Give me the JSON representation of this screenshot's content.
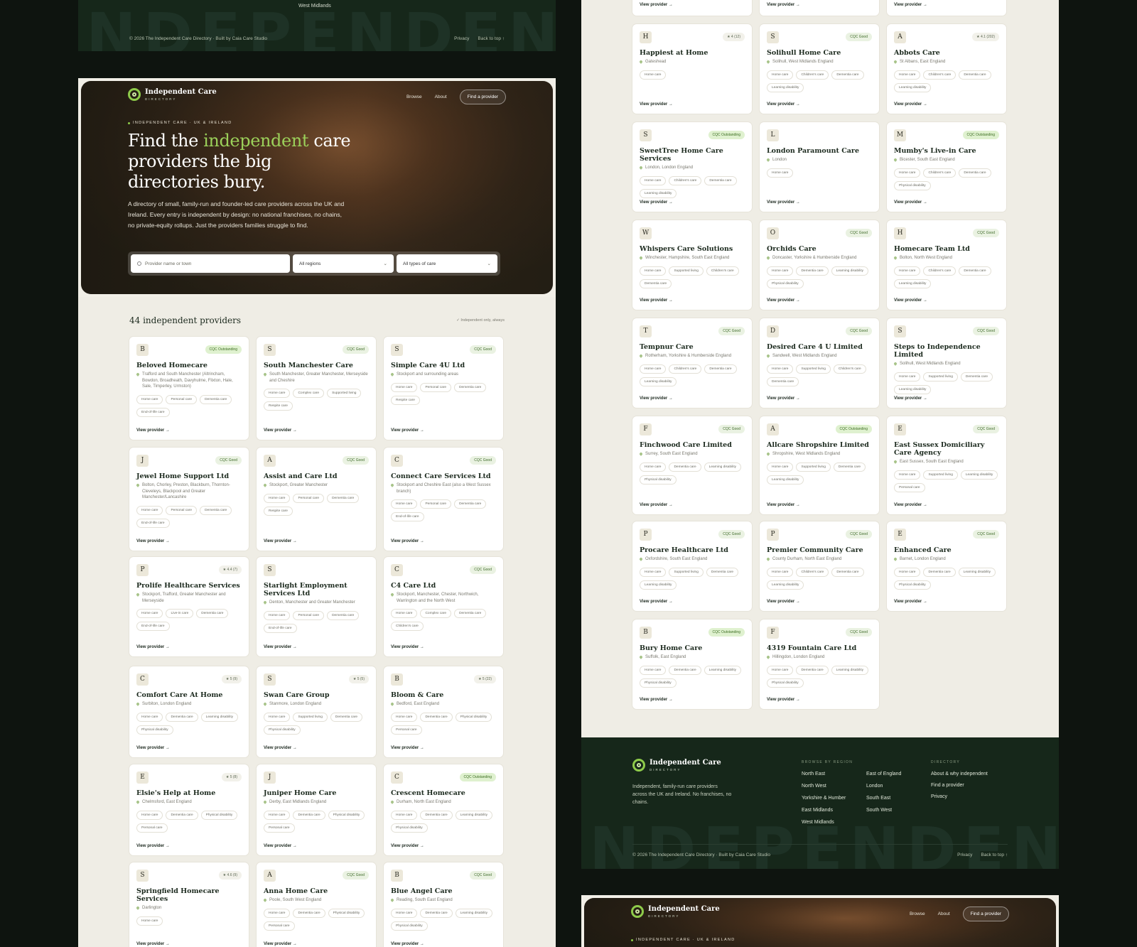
{
  "brand": {
    "name": "Independent Care",
    "sub": "DIRECTORY"
  },
  "nav": {
    "browse": "Browse",
    "about": "About",
    "cta": "Find a provider"
  },
  "hero": {
    "eyebrow": "INDEPENDENT CARE · UK & IRELAND",
    "title_pre": "Find the ",
    "title_hl": "independent",
    "title_post": " care providers the big directories bury.",
    "lead": "A directory of small, family-run and founder-led care providers across the UK and Ireland. Every entry is independent by design: no national franchises, no chains, no private-equity rollups. Just the providers families struggle to find.",
    "search_placeholder": "Provider name or town",
    "region": "All regions",
    "care": "All types of care"
  },
  "listing": {
    "count": "44 independent providers",
    "note": "Independent only, always",
    "view": "View provider →"
  },
  "footer": {
    "top_region": "West Midlands",
    "copy": "© 2026 The Independent Care Directory · Built by Caia Care Studio",
    "privacy": "Privacy",
    "back": "Back to top ↑",
    "bigword": "INDEPENDENT CARE",
    "tagline": "Independent, family-run care providers across the UK and Ireland. No franchises, no chains.",
    "browse_heading": "BROWSE BY REGION",
    "regions": [
      "North East",
      "North West",
      "Yorkshire & Humber",
      "East Midlands",
      "West Midlands",
      "East of England",
      "London",
      "South East",
      "South West"
    ],
    "dir_heading": "DIRECTORY",
    "dir_links": [
      "About & why independent",
      "Find a provider",
      "Privacy"
    ]
  },
  "left_cards": [
    {
      "i": "B",
      "b": "CQC Outstanding",
      "bt": "o",
      "n": "Beloved Homecare",
      "l": "Trafford and South Manchester (Altrincham, Bowdon, Broadheath, Davyhulme, Flixton, Hale, Sale, Timperley, Urmston)",
      "t": [
        "Home care",
        "Personal care",
        "Dementia care",
        "End-of-life care"
      ]
    },
    {
      "i": "S",
      "b": "CQC Good",
      "bt": "g",
      "n": "South Manchester Care",
      "l": "South Manchester, Greater Manchester, Merseyside and Cheshire",
      "t": [
        "Home care",
        "Complex care",
        "Supported living",
        "Respite care"
      ]
    },
    {
      "i": "S",
      "b": "CQC Good",
      "bt": "g",
      "n": "Simple Care 4U Ltd",
      "l": "Stockport and surrounding areas",
      "t": [
        "Home care",
        "Personal care",
        "Dementia care",
        "Respite care"
      ]
    },
    {
      "i": "J",
      "b": "CQC Good",
      "bt": "g",
      "n": "Jewel Home Support Ltd",
      "l": "Bolton, Chorley, Preston, Blackburn, Thornton-Cleveleys, Blackpool and Greater Manchester/Lancashire",
      "t": [
        "Home care",
        "Personal care",
        "Dementia care",
        "End-of-life care"
      ]
    },
    {
      "i": "A",
      "b": "CQC Good",
      "bt": "g",
      "n": "Assist and Care Ltd",
      "l": "Stockport, Greater Manchester",
      "t": [
        "Home care",
        "Personal care",
        "Dementia care",
        "Respite care"
      ]
    },
    {
      "i": "C",
      "b": "CQC Good",
      "bt": "g",
      "n": "Connect Care Services Ltd",
      "l": "Stockport and Cheshire East (also a West Sussex branch)",
      "t": [
        "Home care",
        "Personal care",
        "Dementia care",
        "End-of-life care"
      ]
    },
    {
      "i": "P",
      "b": "★ 4.4 (7)",
      "bt": "",
      "n": "Prolife Healthcare Services",
      "l": "Stockport, Trafford, Greater Manchester and Merseyside",
      "t": [
        "Home care",
        "Live-in care",
        "Dementia care",
        "End-of-life care"
      ]
    },
    {
      "i": "S",
      "b": "",
      "bt": "",
      "n": "Starlight Employment Services Ltd",
      "l": "Denton, Manchester and Greater Manchester",
      "t": [
        "Home care",
        "Personal care",
        "Dementia care",
        "End-of-life care"
      ]
    },
    {
      "i": "C",
      "b": "CQC Good",
      "bt": "g",
      "n": "C4 Care Ltd",
      "l": "Stockport, Manchester, Chester, Northwich, Warrington and the North West",
      "t": [
        "Home care",
        "Complex care",
        "Dementia care",
        "Children's care"
      ]
    },
    {
      "i": "C",
      "b": "★ 5 (9)",
      "bt": "",
      "n": "Comfort Care At Home",
      "l": "Surbiton, London England",
      "t": [
        "Home care",
        "Dementia care",
        "Learning disability",
        "Physical disability"
      ]
    },
    {
      "i": "S",
      "b": "★ 5 (5)",
      "bt": "",
      "n": "Swan Care Group",
      "l": "Stanmore, London England",
      "t": [
        "Home care",
        "Supported living",
        "Dementia care",
        "Physical disability"
      ]
    },
    {
      "i": "B",
      "b": "★ 5 (22)",
      "bt": "",
      "n": "Bloom & Care",
      "l": "Bedford, East England",
      "t": [
        "Home care",
        "Dementia care",
        "Physical disability",
        "Personal care"
      ]
    },
    {
      "i": "E",
      "b": "★ 5 (8)",
      "bt": "",
      "n": "Elsie's Help at Home",
      "l": "Chelmsford, East England",
      "t": [
        "Home care",
        "Dementia care",
        "Physical disability",
        "Personal care"
      ]
    },
    {
      "i": "J",
      "b": "",
      "bt": "",
      "n": "Juniper Home Care",
      "l": "Derby, East Midlands England",
      "t": [
        "Home care",
        "Dementia care",
        "Physical disability",
        "Personal care"
      ]
    },
    {
      "i": "C",
      "b": "CQC Outstanding",
      "bt": "o",
      "n": "Crescent Homecare",
      "l": "Durham, North East England",
      "t": [
        "Home care",
        "Dementia care",
        "Learning disability",
        "Physical disability"
      ]
    },
    {
      "i": "S",
      "b": "★ 4.6 (9)",
      "bt": "",
      "n": "Springfield Homecare Services",
      "l": "Darlington",
      "t": [
        "Home care"
      ]
    },
    {
      "i": "A",
      "b": "CQC Good",
      "bt": "g",
      "n": "Anna Home Care",
      "l": "Poole, South West England",
      "t": [
        "Home care",
        "Dementia care",
        "Physical disability",
        "Personal care"
      ]
    },
    {
      "i": "B",
      "b": "CQC Good",
      "bt": "g",
      "n": "Blue Angel Care",
      "l": "Reading, South East England",
      "t": [
        "Home care",
        "Dementia care",
        "Learning disability",
        "Physical disability"
      ]
    }
  ],
  "right_cards": [
    {
      "i": "H",
      "b": "★ 4 (12)",
      "bt": "",
      "n": "Happiest at Home",
      "l": "Gateshead",
      "t": [
        "Home care"
      ]
    },
    {
      "i": "S",
      "b": "CQC Good",
      "bt": "g",
      "n": "Solihull Home Care",
      "l": "Solihull, West Midlands England",
      "t": [
        "Home care",
        "Children's care",
        "Dementia care",
        "Learning disability"
      ]
    },
    {
      "i": "A",
      "b": "★ 4.1 (202)",
      "bt": "",
      "n": "Abbots Care",
      "l": "St Albans, East England",
      "t": [
        "Home care",
        "Children's care",
        "Dementia care",
        "Learning disability"
      ]
    },
    {
      "i": "S",
      "b": "CQC Outstanding",
      "bt": "o",
      "n": "SweetTree Home Care Services",
      "l": "London, London England",
      "t": [
        "Home care",
        "Children's care",
        "Dementia care",
        "Learning disability"
      ]
    },
    {
      "i": "L",
      "b": "",
      "bt": "",
      "n": "London Paramount Care",
      "l": "London",
      "t": [
        "Home care"
      ]
    },
    {
      "i": "M",
      "b": "CQC Outstanding",
      "bt": "o",
      "n": "Mumby's Live-in Care",
      "l": "Bicester, South East England",
      "t": [
        "Home care",
        "Children's care",
        "Dementia care",
        "Physical disability"
      ]
    },
    {
      "i": "W",
      "b": "",
      "bt": "",
      "n": "Whispers Care Solutions",
      "l": "Winchester, Hampshire, South East England",
      "t": [
        "Home care",
        "Supported living",
        "Children's care",
        "Dementia care"
      ]
    },
    {
      "i": "O",
      "b": "CQC Good",
      "bt": "g",
      "n": "Orchids Care",
      "l": "Doncaster, Yorkshire & Humberside England",
      "t": [
        "Home care",
        "Dementia care",
        "Learning disability",
        "Physical disability"
      ]
    },
    {
      "i": "H",
      "b": "CQC Good",
      "bt": "g",
      "n": "Homecare Team Ltd",
      "l": "Bolton, North West England",
      "t": [
        "Home care",
        "Children's care",
        "Dementia care",
        "Learning disability"
      ]
    },
    {
      "i": "T",
      "b": "CQC Good",
      "bt": "g",
      "n": "Tempnur Care",
      "l": "Rotherham, Yorkshire & Humberside England",
      "t": [
        "Home care",
        "Children's care",
        "Dementia care",
        "Learning disability"
      ]
    },
    {
      "i": "D",
      "b": "CQC Good",
      "bt": "g",
      "n": "Desired Care 4 U Limited",
      "l": "Sandwell, West Midlands England",
      "t": [
        "Home care",
        "Supported living",
        "Children's care",
        "Dementia care"
      ]
    },
    {
      "i": "S",
      "b": "CQC Good",
      "bt": "g",
      "n": "Steps to Independence Limited",
      "l": "Solihull, West Midlands England",
      "t": [
        "Home care",
        "Supported living",
        "Dementia care",
        "Learning disability"
      ]
    },
    {
      "i": "F",
      "b": "CQC Good",
      "bt": "g",
      "n": "Finchwood Care Limited",
      "l": "Surrey, South East England",
      "t": [
        "Home care",
        "Dementia care",
        "Learning disability",
        "Physical disability"
      ]
    },
    {
      "i": "A",
      "b": "CQC Outstanding",
      "bt": "o",
      "n": "Allcare Shropshire Limited",
      "l": "Shropshire, West Midlands England",
      "t": [
        "Home care",
        "Supported living",
        "Dementia care",
        "Learning disability"
      ]
    },
    {
      "i": "E",
      "b": "CQC Good",
      "bt": "g",
      "n": "East Sussex Domiciliary Care Agency",
      "l": "East Sussex, South East England",
      "t": [
        "Home care",
        "Supported living",
        "Learning disability",
        "Personal care"
      ]
    },
    {
      "i": "P",
      "b": "CQC Good",
      "bt": "g",
      "n": "Procare Healthcare Ltd",
      "l": "Oxfordshire, South East England",
      "t": [
        "Home care",
        "Supported living",
        "Dementia care",
        "Learning disability"
      ]
    },
    {
      "i": "P",
      "b": "CQC Good",
      "bt": "g",
      "n": "Premier Community Care",
      "l": "County Durham, North East England",
      "t": [
        "Home care",
        "Children's care",
        "Dementia care",
        "Learning disability"
      ]
    },
    {
      "i": "E",
      "b": "CQC Good",
      "bt": "g",
      "n": "Enhanced Care",
      "l": "Barnet, London England",
      "t": [
        "Home care",
        "Dementia care",
        "Learning disability",
        "Physical disability"
      ]
    },
    {
      "i": "B",
      "b": "CQC Outstanding",
      "bt": "o",
      "n": "Bury Home Care",
      "l": "Suffolk, East England",
      "t": [
        "Home care",
        "Dementia care",
        "Learning disability",
        "Physical disability"
      ]
    },
    {
      "i": "F",
      "b": "CQC Good",
      "bt": "g",
      "n": "4319 Fountain Care Ltd",
      "l": "Hillingdon, London England",
      "t": [
        "Home care",
        "Dementia care",
        "Learning disability",
        "Physical disability"
      ]
    }
  ]
}
